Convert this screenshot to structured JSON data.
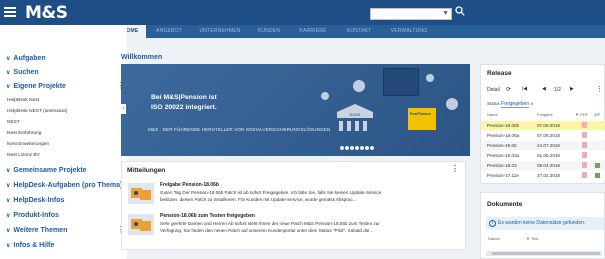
{
  "header": {
    "logo": "M&S",
    "search_placeholder": ""
  },
  "nav": {
    "tabs": [
      {
        "label": "HOME",
        "active": true
      },
      {
        "label": "ANGEBOT",
        "active": false
      },
      {
        "label": "UNTERNEHMEN",
        "active": false
      },
      {
        "label": "KUNDEN",
        "active": false
      },
      {
        "label": "KARRIERE",
        "active": false
      },
      {
        "label": "KONTAKT",
        "active": false
      },
      {
        "label": "VERWALTUNG",
        "active": false
      }
    ]
  },
  "sidebar": {
    "items": [
      {
        "label": "Aufgaben"
      },
      {
        "label": "Suchen"
      },
      {
        "label": "Eigene Projekte"
      },
      {
        "label": "Gemeinsame Projekte"
      },
      {
        "label": "HelpDesk-Aufgaben (pro Thema)"
      },
      {
        "label": "HelpDesk-Infos"
      },
      {
        "label": "Produkt-Infos"
      },
      {
        "label": "Weitere Themen"
      },
      {
        "label": "Infos & Hilfe"
      }
    ],
    "projects": [
      "HelpDesk Nest",
      "HelpDesk NEST (antessara)",
      "NEST",
      "Nest Einführung",
      "Nest Erweiterungen",
      "Nest Lizenz BV"
    ]
  },
  "main": {
    "welcome": "Willkommen",
    "banner": {
      "line1": "Bei M&S|Pension ist",
      "line2": "ISO 20022 integriert.",
      "subline": "M&S · DER FÜHRENDE HERSTELLER VON SOZIALVERSICHERUNGSLÖSUNGEN",
      "bank_label": "BANK",
      "postfinance_label": "PostFinance"
    },
    "mitteilungen": {
      "title": "Mitteilungen",
      "messages": [
        {
          "title": "Freigabe Pension-18.06b",
          "body1": "Guten Tag Der Pension-18.06b Patch ist ab sofort Freigegeben. Ich bitte Sie, falls Sie keinen Update-Service",
          "body2": "besitzen, diesen Patch zu installieren. Für Kunden mit Update-Service, wurde gemäss Absprac..."
        },
        {
          "title": "Pension-18.06b zum Testen freigegeben",
          "body1": "Sehr geehrte Damen und Herren Ab sofort steht Ihnen der neue Patch M&S Pension-18.06b zum Testen zur",
          "body2": "Verfügung. Sie finden den neuen Patch auf unserem Kundenportal unter dem Status \"Pilot\". Sobald die..."
        }
      ]
    }
  },
  "release": {
    "title": "Release",
    "toolbar": {
      "detail": "Detail",
      "page": "1/2"
    },
    "status_label": "Status",
    "status_value": "Freigegeben",
    "columns": {
      "name": "Name",
      "freigabe": "Freigabe",
      "pdf": "▼ PDF",
      "zip": "ZIP"
    },
    "rows": [
      {
        "name": "Pension-18.06b",
        "date": "07.09.2018",
        "zip": false,
        "selected": true
      },
      {
        "name": "Pension-18.06a",
        "date": "07.08.2018",
        "zip": false,
        "selected": false
      },
      {
        "name": "Pension-18.06",
        "date": "24.07.2018",
        "zip": false,
        "selected": false
      },
      {
        "name": "Pension-18.03a",
        "date": "01.05.2018",
        "zip": false,
        "selected": false
      },
      {
        "name": "Pension-18.03",
        "date": "09.04.2018",
        "zip": true,
        "selected": false
      },
      {
        "name": "Pension-17.11e",
        "date": "27.02.2018",
        "zip": true,
        "selected": false
      }
    ]
  },
  "dokumente": {
    "title": "Dokumente",
    "info": "Es wurden keine Datensätze gefunden.",
    "col_datum": "Datum",
    "col_titel": "▼ Titel"
  },
  "colors": {
    "header": "#1f4e86",
    "nav": "#2a6099",
    "accent": "#1f5a9e",
    "selected_row": "#fdf5a6"
  }
}
